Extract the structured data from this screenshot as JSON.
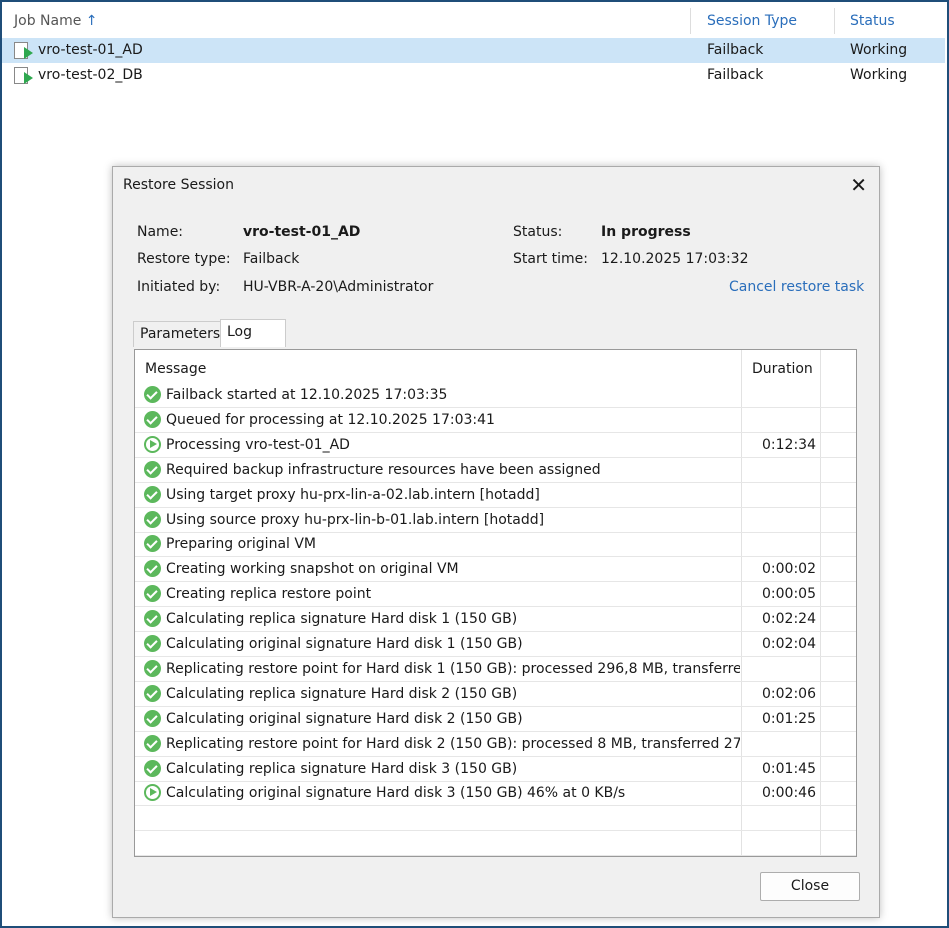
{
  "jobs": {
    "columns": {
      "name": "Job Name",
      "sort_icon": "↑",
      "type": "Session Type",
      "status": "Status"
    },
    "rows": [
      {
        "name": "vro-test-01_AD",
        "type": "Failback",
        "status": "Working"
      },
      {
        "name": "vro-test-02_DB",
        "type": "Failback",
        "status": "Working"
      }
    ]
  },
  "dialog": {
    "title": "Restore Session",
    "close_icon": "✕",
    "name_label": "Name:",
    "name": "vro-test-01_AD",
    "type_label": "Restore type:",
    "type": "Failback",
    "init_label": "Initiated by:",
    "init": "HU-VBR-A-20\\Administrator",
    "status_label": "Status:",
    "status": "In progress",
    "start_label": "Start time:",
    "start": "12.10.2025 17:03:32",
    "cancel": "Cancel restore task",
    "tabs": [
      "Parameters",
      "Log"
    ],
    "log_headers": {
      "message": "Message",
      "duration": "Duration"
    },
    "log": [
      {
        "s": "ok",
        "m": "Failback started at 12.10.2025 17:03:35",
        "d": ""
      },
      {
        "s": "ok",
        "m": "Queued for processing at 12.10.2025 17:03:41",
        "d": ""
      },
      {
        "s": "run",
        "m": "Processing vro-test-01_AD",
        "d": "0:12:34"
      },
      {
        "s": "ok",
        "m": "Required backup infrastructure resources have been assigned",
        "d": ""
      },
      {
        "s": "ok",
        "m": "Using target proxy hu-prx-lin-a-02.lab.intern [hotadd]",
        "d": ""
      },
      {
        "s": "ok",
        "m": "Using source proxy hu-prx-lin-b-01.lab.intern [hotadd]",
        "d": ""
      },
      {
        "s": "ok",
        "m": "Preparing original VM",
        "d": ""
      },
      {
        "s": "ok",
        "m": "Creating working snapshot on original VM",
        "d": "0:00:02"
      },
      {
        "s": "ok",
        "m": "Creating replica restore point",
        "d": "0:00:05"
      },
      {
        "s": "ok",
        "m": "Calculating replica signature Hard disk 1 (150 GB)",
        "d": "0:02:24"
      },
      {
        "s": "ok",
        "m": "Calculating original signature Hard disk 1 (150 GB)",
        "d": "0:02:04"
      },
      {
        "s": "ok",
        "m": "Replicating restore point for Hard disk 1 (150 GB): processed 296,8 MB, transferre...",
        "d": ""
      },
      {
        "s": "ok",
        "m": "Calculating replica signature Hard disk 2 (150 GB)",
        "d": "0:02:06"
      },
      {
        "s": "ok",
        "m": "Calculating original signature Hard disk 2 (150 GB)",
        "d": "0:01:25"
      },
      {
        "s": "ok",
        "m": "Replicating restore point for Hard disk 2 (150 GB): processed 8 MB, transferred 27...",
        "d": ""
      },
      {
        "s": "ok",
        "m": "Calculating replica signature Hard disk 3 (150 GB)",
        "d": "0:01:45"
      },
      {
        "s": "run",
        "m": "Calculating original signature Hard disk 3 (150 GB) 46% at 0 KB/s",
        "d": "0:00:46"
      }
    ],
    "close_button": "Close"
  }
}
